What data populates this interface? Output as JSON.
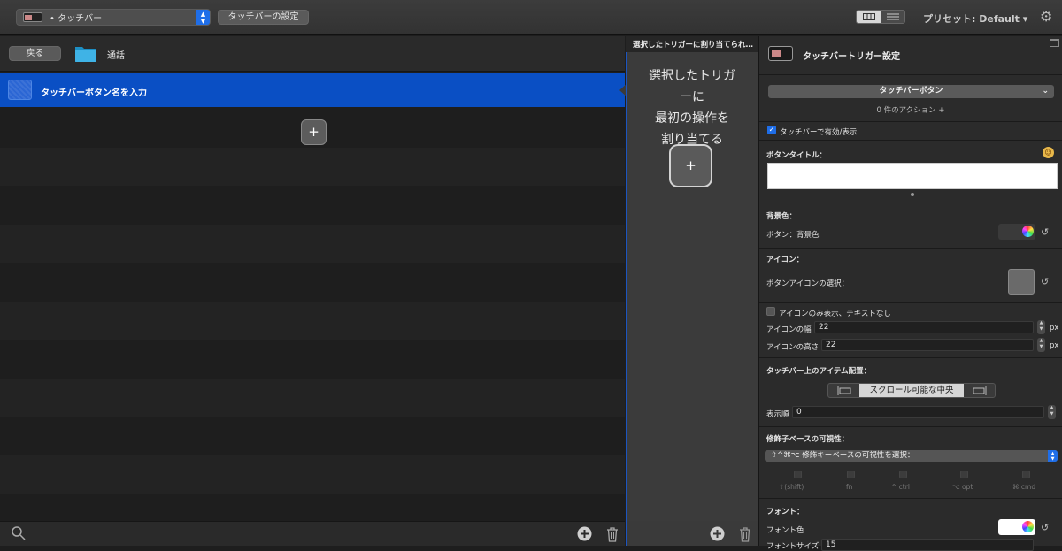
{
  "toolbar": {
    "context_popup": "• タッチバー",
    "touchbar_settings": "タッチバーの設定",
    "preset_label": "プリセット: Default ▾"
  },
  "left": {
    "back": "戻る",
    "group_name": "通話",
    "selected_row": "タッチバーボタン名を入力"
  },
  "middle": {
    "header": "選択したトリガーに割り当てられ…",
    "lines": [
      "選択したトリガ",
      "ーに",
      "最初の操作を",
      "割り当てる"
    ]
  },
  "right": {
    "title": "タッチバートリガー設定",
    "type_popup": "タッチバーボタン",
    "action_count": "0 件のアクション +",
    "enabled_label": "タッチバーで有効/表示",
    "button_title_label": "ボタンタイトル：",
    "bg_color_label": "背景色：",
    "bg_color_row": "ボタン：背景色",
    "icon_label": "アイコン：",
    "icon_select": "ボタンアイコンの選択：",
    "icon_only": "アイコンのみ表示、テキストなし",
    "icon_width_label": "アイコンの幅",
    "icon_width_value": "22",
    "icon_height_label": "アイコンの高さ",
    "icon_height_value": "22",
    "unit_px": "px",
    "placement_label": "タッチバー上のアイテム配置：",
    "placement_center": "スクロール可能な中央",
    "order_label": "表示順",
    "order_value": "0",
    "modifier_label": "修飾子ベースの可視性：",
    "modifier_popup": "⇧^⌘⌥ 修飾キーベースの可視性を選択：",
    "mod_keys": [
      "⇧(shift)",
      "fn",
      "^ ctrl",
      "⌥ opt",
      "⌘ cmd"
    ],
    "font_label": "フォント：",
    "font_color_label": "フォント色",
    "font_size_partial": "フォントサイズ",
    "font_size_value": "15"
  },
  "colors": {
    "selection_blue": "#0a4fc4",
    "accent_blue": "#1f6ee8",
    "folder_cyan": "#3fb3e6"
  }
}
